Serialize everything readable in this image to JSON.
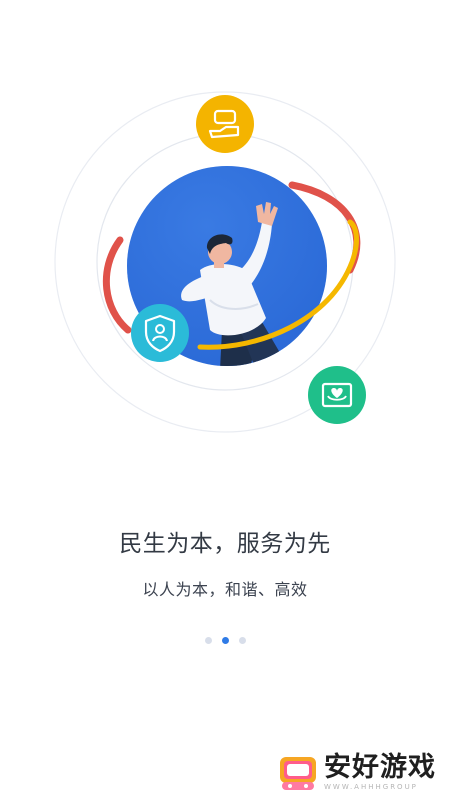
{
  "onboarding": {
    "headline": "民生为本，服务为先",
    "subheadline": "以人为本，和谐、高效",
    "pager": {
      "total": 3,
      "active_index": 1
    },
    "icons": {
      "top": "hand-holding-gift-icon",
      "left": "shield-user-icon",
      "right": "heart-certificate-icon"
    }
  },
  "watermark": {
    "brand": "安好游戏",
    "sub": "WWW.AHHHGROUP"
  },
  "colors": {
    "accent": "#2f7be6",
    "globe_blue": "#2e6fdc",
    "orbit_yellow": "#f5b800",
    "orbit_red": "#e0524a",
    "icon_orange": "#f4b400",
    "icon_cyan": "#2bbbd8",
    "icon_green": "#1fbf8a",
    "dot_inactive": "#d8deea"
  }
}
